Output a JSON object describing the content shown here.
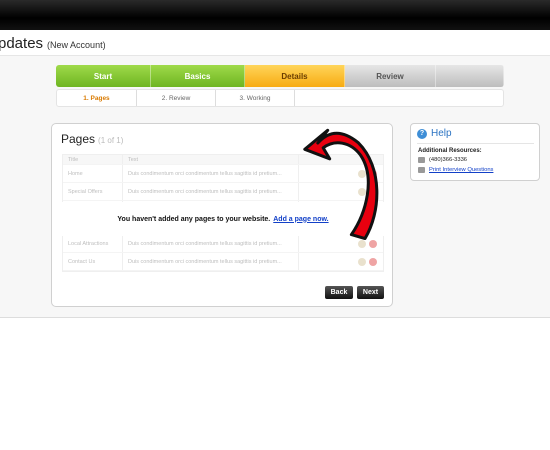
{
  "header": {
    "title": "pdates",
    "subtitle": "(New Account)"
  },
  "steps": [
    {
      "label": "Start",
      "state": "done"
    },
    {
      "label": "Basics",
      "state": "done"
    },
    {
      "label": "Details",
      "state": "current"
    },
    {
      "label": "Review",
      "state": "todo"
    }
  ],
  "substeps": [
    {
      "label": "1. Pages",
      "active": true
    },
    {
      "label": "2. Review",
      "active": false
    },
    {
      "label": "3. Working",
      "active": false
    }
  ],
  "pages": {
    "title": "Pages",
    "count": "(1 of 1)",
    "columns": [
      "Title",
      "Text"
    ],
    "rows": [
      {
        "title": "Home",
        "text": "Duis condimentum orci condimentum tellus sagittis id pretium..."
      },
      {
        "title": "Special Offers",
        "text": "Duis condimentum orci condimentum tellus sagittis id pretium..."
      },
      {
        "title": "",
        "text": ""
      },
      {
        "title": "Local Attractions",
        "text": "Duis condimentum orci condimentum tellus sagittis id pretium..."
      },
      {
        "title": "Contact Us",
        "text": "Duis condimentum orci condimentum tellus sagittis id pretium..."
      }
    ],
    "empty_message": "You haven't added any pages to your website.",
    "add_link": "Add a page now.",
    "back_label": "Back",
    "next_label": "Next"
  },
  "help": {
    "title": "Help",
    "resources_label": "Additional Resources:",
    "phone": "(480)366-3336",
    "print_link": "Print Interview Questions"
  },
  "colors": {
    "arrow": "#e8000f",
    "link": "#1240c8",
    "step_current": "#f7ab12",
    "step_done": "#6eb521"
  }
}
